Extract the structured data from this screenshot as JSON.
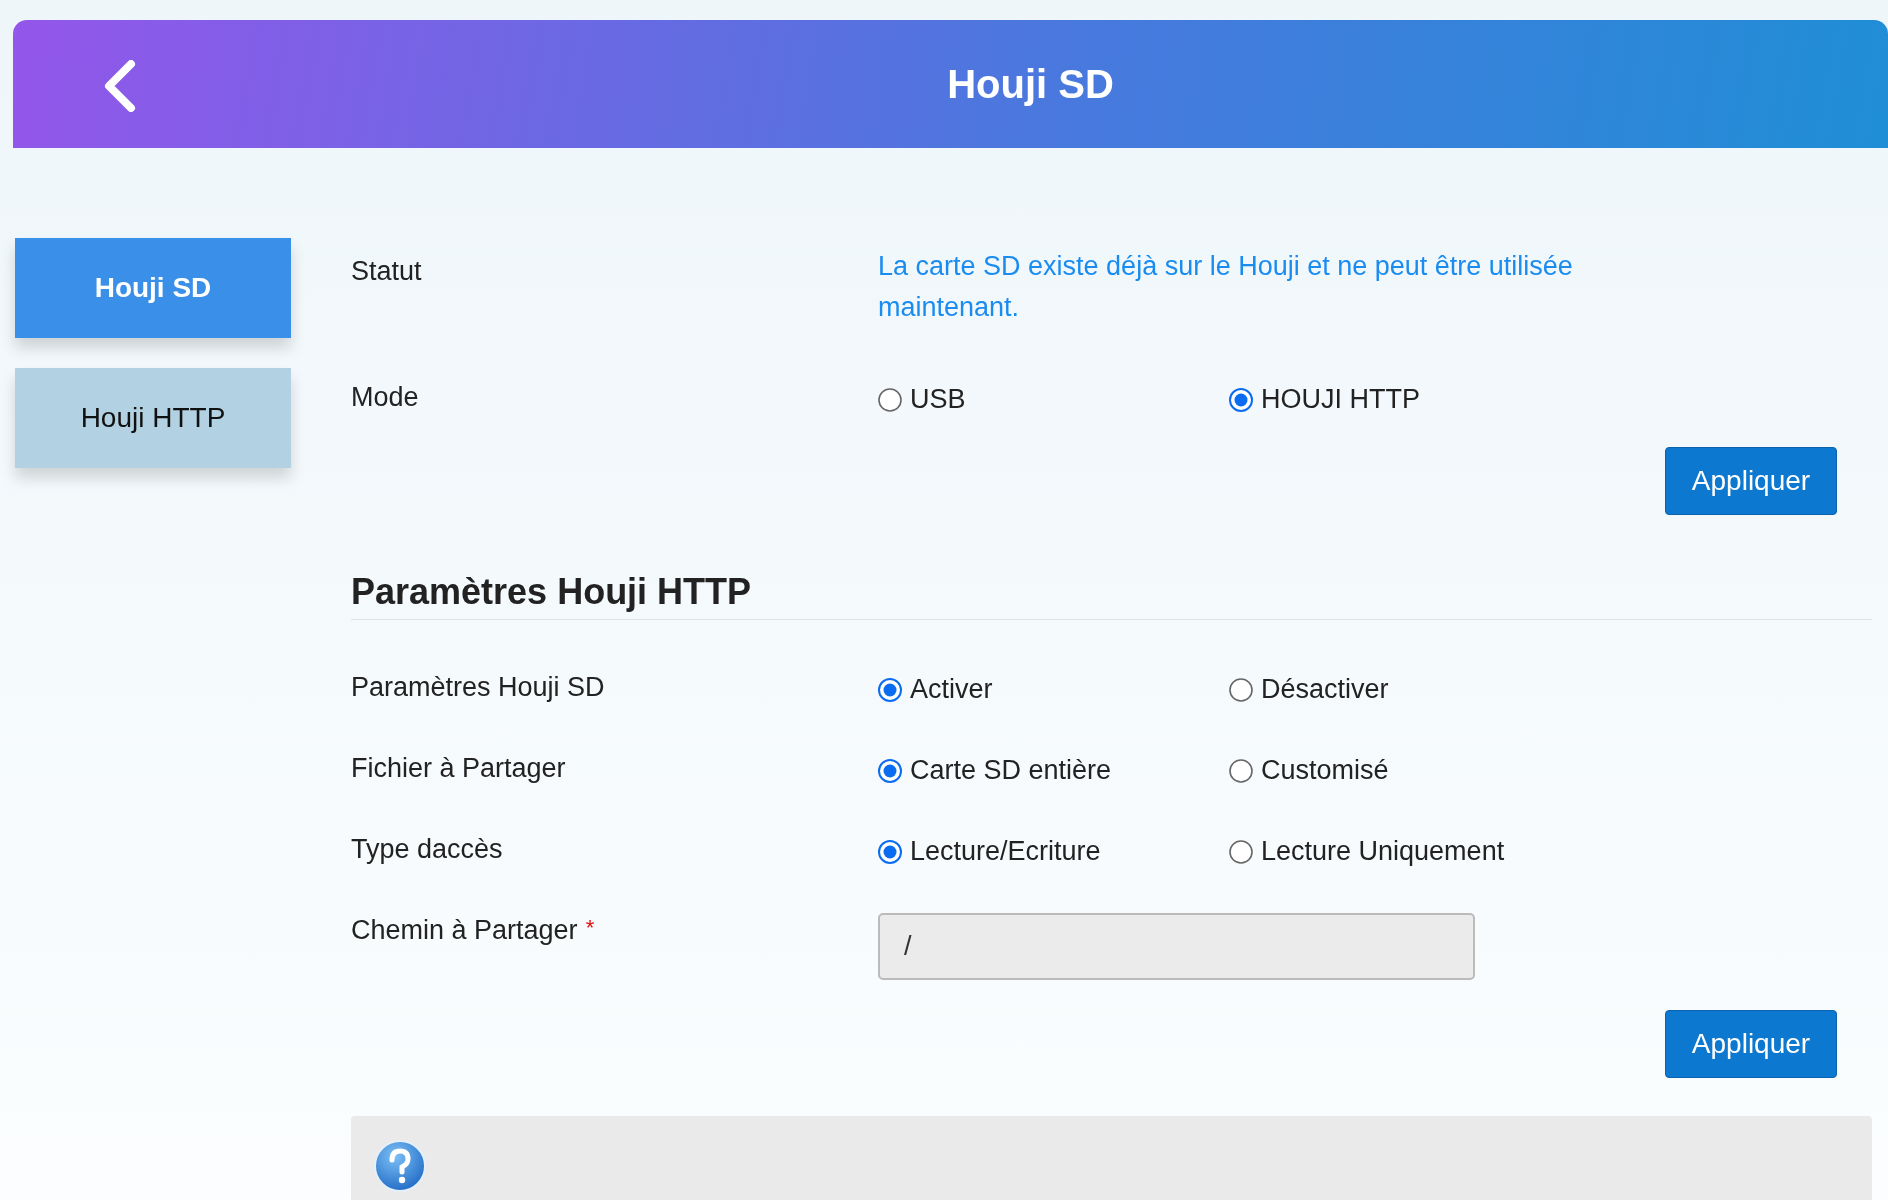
{
  "header": {
    "title": "Houji SD"
  },
  "sidebar": {
    "items": [
      {
        "label": "Houji SD",
        "selected": true
      },
      {
        "label": "Houji HTTP",
        "selected": false
      }
    ]
  },
  "status": {
    "label": "Statut",
    "value": "La carte SD existe déjà sur le Houji et ne peut être utilisée maintenant."
  },
  "mode": {
    "label": "Mode",
    "options": [
      {
        "label": "USB",
        "selected": false
      },
      {
        "label": "HOUJI HTTP",
        "selected": true
      }
    ]
  },
  "apply_button_1": "Appliquer",
  "section": {
    "title": "Paramètres Houji HTTP",
    "rows": [
      {
        "kind": "radio",
        "label": "Paramètres Houji SD",
        "options": [
          {
            "label": "Activer",
            "selected": true
          },
          {
            "label": "Désactiver",
            "selected": false
          }
        ]
      },
      {
        "kind": "radio",
        "label": "Fichier à Partager",
        "options": [
          {
            "label": "Carte SD entière",
            "selected": true
          },
          {
            "label": "Customisé",
            "selected": false
          }
        ]
      },
      {
        "kind": "radio",
        "label": "Type daccès",
        "options": [
          {
            "label": "Lecture/Ecriture",
            "selected": true
          },
          {
            "label": "Lecture Uniquement",
            "selected": false
          }
        ]
      },
      {
        "kind": "input",
        "label": "Chemin à Partager",
        "required_mark": "*",
        "value": "/"
      }
    ]
  },
  "apply_button_2": "Appliquer"
}
